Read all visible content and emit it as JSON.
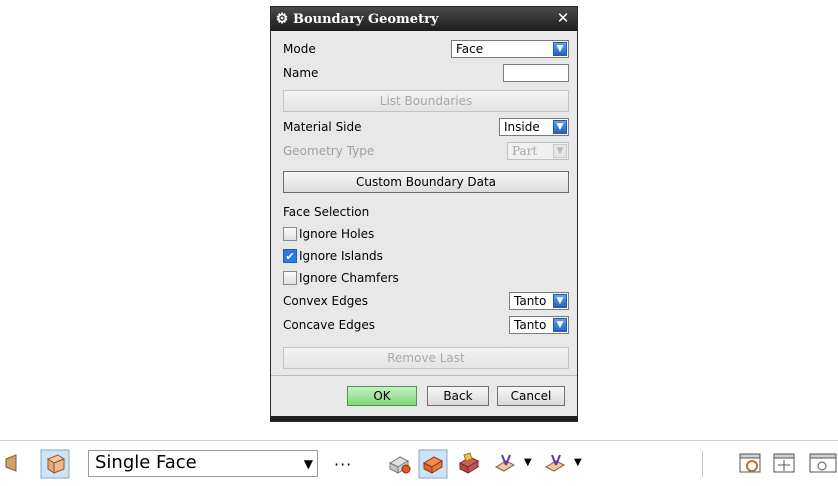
{
  "dialog": {
    "title": "Boundary Geometry",
    "mode_label": "Mode",
    "mode_value": "Face",
    "name_label": "Name",
    "name_value": "",
    "list_boundaries_label": "List Boundaries",
    "material_side_label": "Material Side",
    "material_side_value": "Inside",
    "geometry_type_label": "Geometry Type",
    "geometry_type_value": "Part",
    "custom_boundary_label": "Custom Boundary Data",
    "face_selection_label": "Face Selection",
    "ignore_holes_label": "Ignore Holes",
    "ignore_holes_checked": false,
    "ignore_islands_label": "Ignore Islands",
    "ignore_islands_checked": true,
    "ignore_chamfers_label": "Ignore Chamfers",
    "ignore_chamfers_checked": false,
    "convex_edges_label": "Convex Edges",
    "convex_edges_value": "Tanto",
    "concave_edges_label": "Concave Edges",
    "concave_edges_value": "Tanto",
    "remove_last_label": "Remove Last",
    "ok_label": "OK",
    "back_label": "Back",
    "cancel_label": "Cancel"
  },
  "toolbar": {
    "filter_value": "Single Face",
    "dots": "···"
  }
}
